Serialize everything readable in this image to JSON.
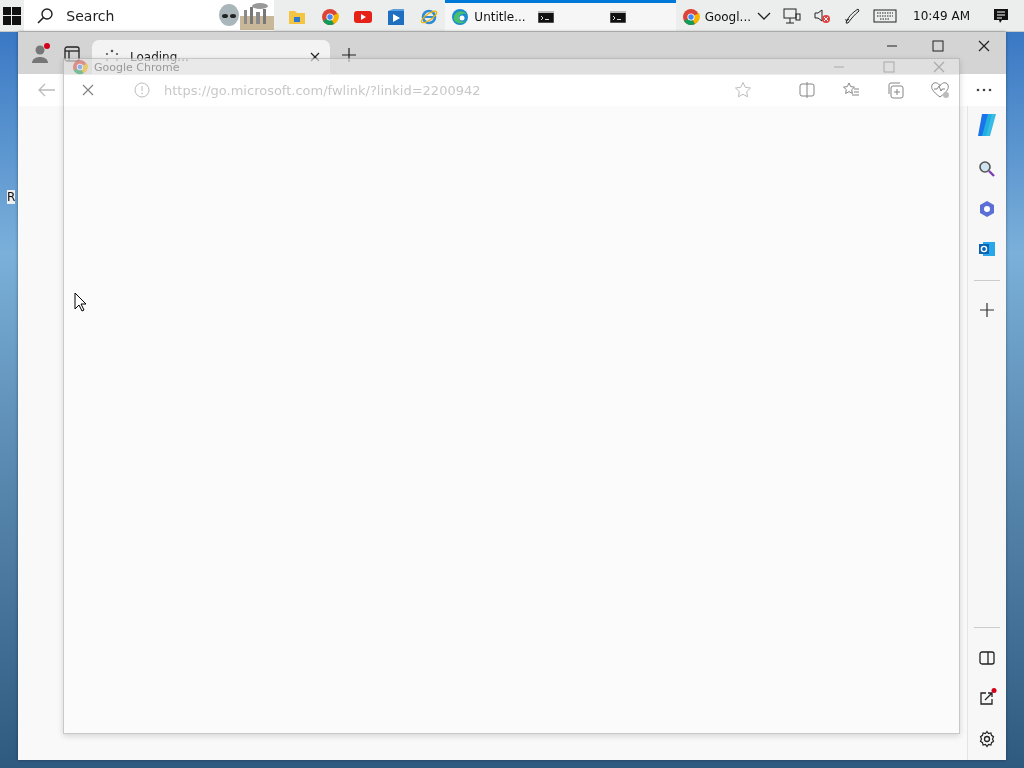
{
  "taskbar": {
    "search": {
      "placeholder": "Search"
    },
    "apps": [
      {
        "kind": "folder",
        "running": false
      },
      {
        "kind": "chrome",
        "running": false
      },
      {
        "kind": "youtube",
        "running": false
      },
      {
        "kind": "player",
        "running": false
      },
      {
        "kind": "ie",
        "running": false
      },
      {
        "kind": "edge",
        "label": "Untitle...",
        "running": true
      },
      {
        "kind": "cmd",
        "running": true
      },
      {
        "kind": "cmd",
        "running": true
      },
      {
        "kind": "chrome",
        "label": "Googl...",
        "running": false
      }
    ],
    "clock": "10:49 AM"
  },
  "desktop": {
    "icon_label": "R"
  },
  "browser": {
    "tab": {
      "title": "Loading..."
    },
    "address": "https://go.microsoft.com/fwlink/?linkid=2200942"
  },
  "overlay_window": {
    "title": "Google Chrome"
  }
}
